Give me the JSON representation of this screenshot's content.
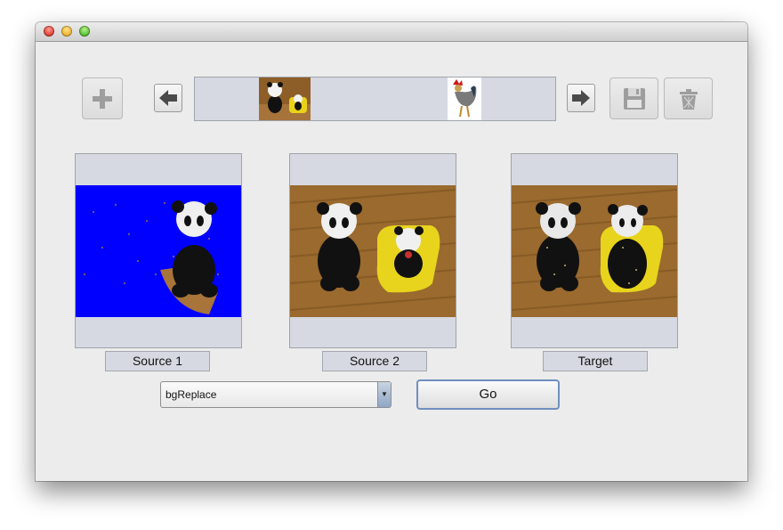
{
  "window": {
    "title": ""
  },
  "toolbar": {
    "add_icon": "plus-icon",
    "prev_icon": "arrow-left-icon",
    "next_icon": "arrow-right-icon",
    "save_icon": "floppy-disk-icon",
    "delete_icon": "trash-icon"
  },
  "panels": [
    {
      "label": "Source 1",
      "image": "panda-blue-background"
    },
    {
      "label": "Source 2",
      "image": "pandas-on-wood-floor"
    },
    {
      "label": "Target",
      "image": "pandas-composite"
    }
  ],
  "controls": {
    "operation_selected": "bgReplace",
    "go_label": "Go"
  },
  "colors": {
    "window_bg": "#ececec",
    "panel_bg": "#d6d9e1",
    "blue_bg": "#0000ff",
    "wood": "#9a6a2e",
    "go_border": "#6f8fbf"
  }
}
